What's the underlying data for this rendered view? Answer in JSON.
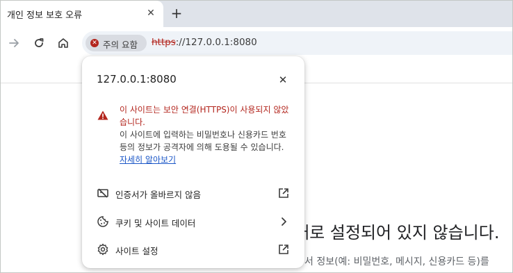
{
  "tab": {
    "title": "개인 정보 보호 오류",
    "close_glyph": "✕"
  },
  "newtab_glyph": "+",
  "toolbar": {
    "chip_label": "주의 요함",
    "url_scheme": "https",
    "url_rest": "://127.0.0.1:8080"
  },
  "popup": {
    "title": "127.0.0.1:8080",
    "close_glyph": "✕",
    "warning_title": "이 사이트는 보안 연결(HTTPS)이 사용되지 않았습니다.",
    "warning_desc": "이 사이트에 입력하는 비밀번호나 신용카드 번호 등의 정보가 공격자에 의해 도용될 수 있습니다.",
    "learn_more": "자세히 알아보기",
    "items": [
      {
        "label": "인증서가 올바르지 않음",
        "icon": "certificate-error-icon",
        "trail": "external-link-icon"
      },
      {
        "label": "쿠키 및 사이트 데이터",
        "icon": "cookie-icon",
        "trail": "chevron-right-icon"
      },
      {
        "label": "사이트 설정",
        "icon": "gear-icon",
        "trail": "external-link-icon"
      }
    ]
  },
  "page": {
    "heading_fragment": "대로 설정되어 있지 않습니다.",
    "body_fragment": "서 정보(예: 비밀번호, 메시지, 신용카드 등)를"
  },
  "colors": {
    "danger": "#b3261e",
    "link": "#1a56c7",
    "tabstrip": "#dfe3ea",
    "omnibox": "#eff3f8"
  }
}
